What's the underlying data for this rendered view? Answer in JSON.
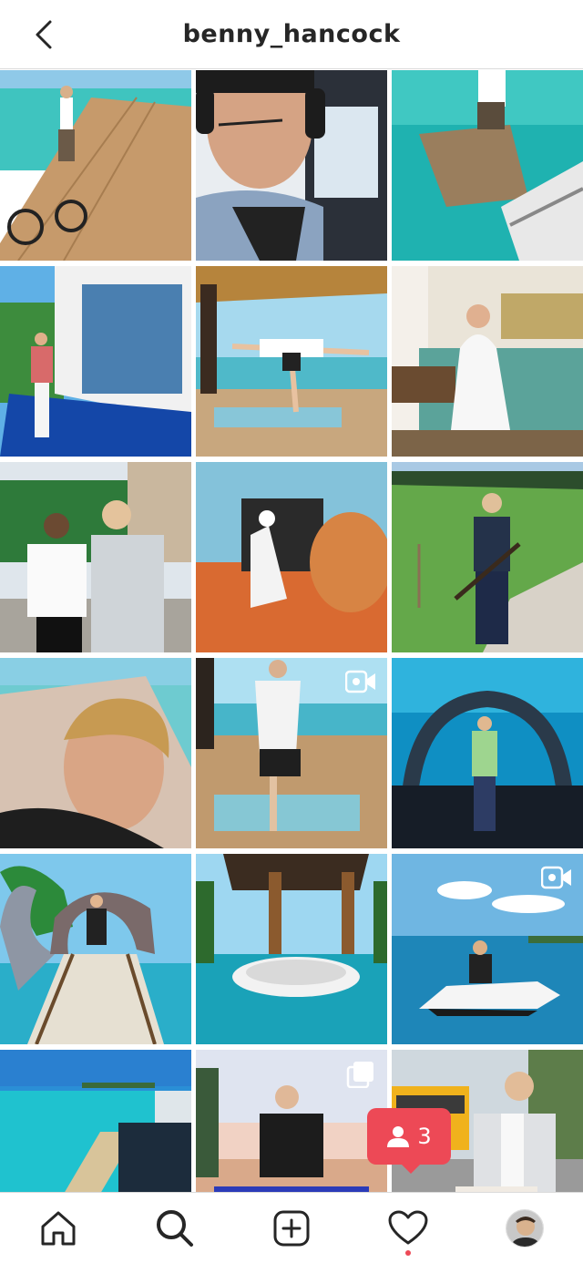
{
  "header": {
    "username": "benny_hancock"
  },
  "grid": {
    "rows": [
      [
        {
          "name": "post-boardwalk-bicycle",
          "kind": "photo"
        },
        {
          "name": "post-pilot-headset",
          "kind": "photo"
        },
        {
          "name": "post-water-deck-stairs",
          "kind": "photo"
        }
      ],
      [
        {
          "name": "post-villa-pool",
          "kind": "photo"
        },
        {
          "name": "post-yoga-deck",
          "kind": "photo"
        },
        {
          "name": "post-bathrobe-bed",
          "kind": "photo"
        }
      ],
      [
        {
          "name": "post-two-friends",
          "kind": "photo"
        },
        {
          "name": "post-desert-sand",
          "kind": "photo"
        },
        {
          "name": "post-field-rifle",
          "kind": "photo"
        }
      ],
      [
        {
          "name": "post-selfie-pillows",
          "kind": "photo"
        },
        {
          "name": "post-tree-pose",
          "kind": "video"
        },
        {
          "name": "post-underwater-restaurant",
          "kind": "photo"
        }
      ],
      [
        {
          "name": "post-whale-bridge",
          "kind": "photo"
        },
        {
          "name": "post-pool-cabana",
          "kind": "photo"
        },
        {
          "name": "post-jet-ski",
          "kind": "video"
        }
      ],
      [
        {
          "name": "post-lagoon-pier",
          "kind": "photo"
        },
        {
          "name": "post-quad-bike",
          "kind": "carousel"
        },
        {
          "name": "post-school-bus",
          "kind": "photo"
        }
      ]
    ]
  },
  "notification": {
    "count": "3",
    "icon": "person-icon"
  },
  "bottom_nav": {
    "items": [
      "home-icon",
      "search-icon",
      "add-post-icon",
      "heart-icon",
      "profile-avatar"
    ]
  },
  "colors": {
    "accent_red": "#ed4956",
    "border": "#dbdbdb"
  }
}
